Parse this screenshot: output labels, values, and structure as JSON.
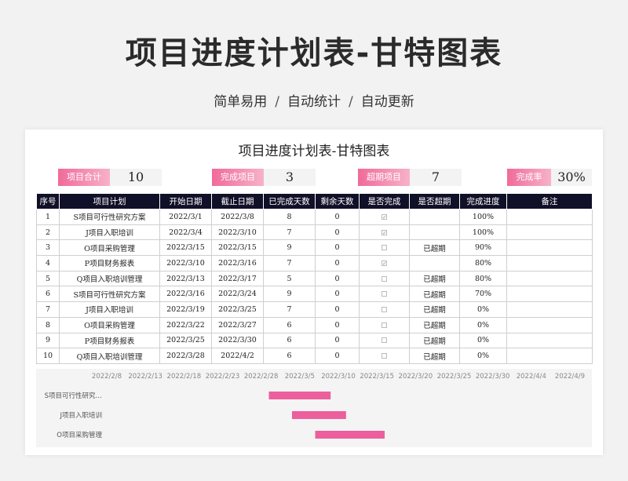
{
  "page": {
    "title": "项目进度计划表-甘特图表",
    "subtitle": [
      "简单易用",
      "自动统计",
      "自动更新"
    ],
    "subtitle_sep": "/"
  },
  "sheet": {
    "title": "项目进度计划表-甘特图表",
    "stats": [
      {
        "label": "项目合计",
        "value": "10"
      },
      {
        "label": "完成项目",
        "value": "3"
      },
      {
        "label": "超期项目",
        "value": "7"
      },
      {
        "label": "完成率",
        "value": "30%"
      }
    ],
    "columns": [
      "序号",
      "项目计划",
      "开始日期",
      "截止日期",
      "已完成天数",
      "剩余天数",
      "是否完成",
      "是否超期",
      "完成进度",
      "备注"
    ],
    "rows": [
      {
        "no": "1",
        "plan": "S项目可行性研究方案",
        "start": "2022/3/1",
        "end": "2022/3/8",
        "done": "8",
        "remain": "0",
        "complete": true,
        "overdue": "",
        "progress": "100%",
        "note": ""
      },
      {
        "no": "2",
        "plan": "J项目入职培训",
        "start": "2022/3/4",
        "end": "2022/3/10",
        "done": "7",
        "remain": "0",
        "complete": true,
        "overdue": "",
        "progress": "100%",
        "note": ""
      },
      {
        "no": "3",
        "plan": "O项目采购管理",
        "start": "2022/3/15",
        "end": "2022/3/15",
        "done": "9",
        "remain": "0",
        "complete": false,
        "overdue": "已超期",
        "progress": "90%",
        "note": ""
      },
      {
        "no": "4",
        "plan": "P项目财务报表",
        "start": "2022/3/10",
        "end": "2022/3/16",
        "done": "7",
        "remain": "0",
        "complete": true,
        "overdue": "",
        "progress": "80%",
        "note": ""
      },
      {
        "no": "5",
        "plan": "Q项目入职培训管理",
        "start": "2022/3/13",
        "end": "2022/3/17",
        "done": "5",
        "remain": "0",
        "complete": false,
        "overdue": "已超期",
        "progress": "80%",
        "note": ""
      },
      {
        "no": "6",
        "plan": "S项目可行性研究方案",
        "start": "2022/3/16",
        "end": "2022/3/24",
        "done": "9",
        "remain": "0",
        "complete": false,
        "overdue": "已超期",
        "progress": "70%",
        "note": ""
      },
      {
        "no": "7",
        "plan": "J项目入职培训",
        "start": "2022/3/19",
        "end": "2022/3/25",
        "done": "7",
        "remain": "0",
        "complete": false,
        "overdue": "已超期",
        "progress": "0%",
        "note": ""
      },
      {
        "no": "8",
        "plan": "O项目采购管理",
        "start": "2022/3/22",
        "end": "2022/3/27",
        "done": "6",
        "remain": "0",
        "complete": false,
        "overdue": "已超期",
        "progress": "0%",
        "note": ""
      },
      {
        "no": "9",
        "plan": "P项目财务报表",
        "start": "2022/3/25",
        "end": "2022/3/30",
        "done": "6",
        "remain": "0",
        "complete": false,
        "overdue": "已超期",
        "progress": "0%",
        "note": ""
      },
      {
        "no": "10",
        "plan": "Q项目入职培训管理",
        "start": "2022/3/28",
        "end": "2022/4/2",
        "done": "6",
        "remain": "0",
        "complete": false,
        "overdue": "已超期",
        "progress": "0%",
        "note": ""
      }
    ]
  },
  "chart_data": {
    "type": "bar",
    "orientation": "horizontal-gantt",
    "x_ticks": [
      "2022/2/8",
      "2022/2/13",
      "2022/2/18",
      "2022/2/23",
      "2022/2/28",
      "2022/3/5",
      "2022/3/10",
      "2022/3/15",
      "2022/3/20",
      "2022/3/25",
      "2022/3/30",
      "2022/4/4",
      "2022/4/9"
    ],
    "xlim": [
      "2022/2/8",
      "2022/4/9"
    ],
    "categories": [
      "S项目可行性研究…",
      "J项目入职培训",
      "O项目采购管理"
    ],
    "series": [
      {
        "start": [
          "2022/3/1",
          "2022/3/4",
          "2022/3/7"
        ],
        "end": [
          "2022/3/9",
          "2022/3/11",
          "2022/3/16"
        ]
      }
    ],
    "bar_color": "#ec5f9c",
    "grid": false
  }
}
